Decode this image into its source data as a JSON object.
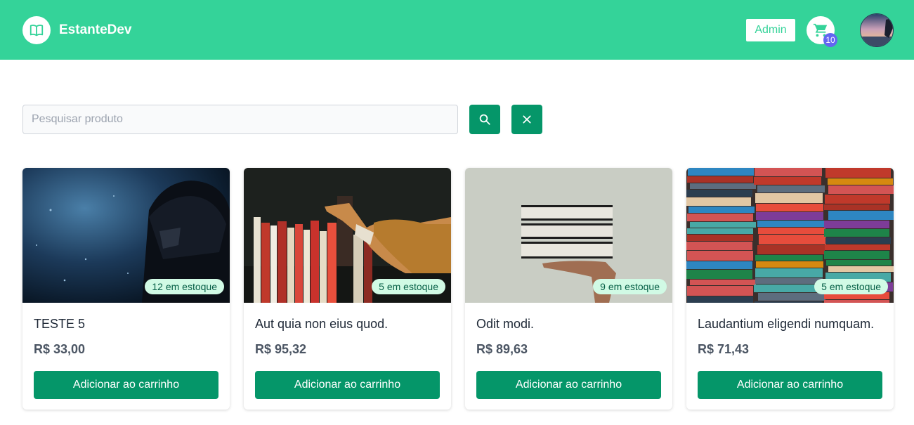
{
  "header": {
    "brand_name": "EstanteDev",
    "brand_icon": "open-book-icon",
    "admin_label": "Admin",
    "cart_icon": "cart-icon",
    "cart_count": "10",
    "colors": {
      "header_bg": "#34d399",
      "badge_bg": "#6366f1"
    }
  },
  "search": {
    "placeholder": "Pesquisar produto",
    "value": "",
    "search_icon": "search-icon",
    "clear_icon": "close-icon"
  },
  "products": [
    {
      "title": "TESTE 5",
      "price": "R$ 33,00",
      "stock": "12 em estoque",
      "button": "Adicionar ao carrinho",
      "image": "dark-helmet-photo"
    },
    {
      "title": "Aut quia non eius quod.",
      "price": "R$ 95,32",
      "stock": "5 em estoque",
      "button": "Adicionar ao carrinho",
      "image": "bookshelf-hand-photo"
    },
    {
      "title": "Odit modi.",
      "price": "R$ 89,63",
      "stock": "9 em estoque",
      "button": "Adicionar ao carrinho",
      "image": "book-stack-hand-photo"
    },
    {
      "title": "Laudantium eligendi numquam.",
      "price": "R$ 71,43",
      "stock": "5 em estoque",
      "button": "Adicionar ao carrinho",
      "image": "colorful-books-photo"
    }
  ],
  "colors": {
    "primary": "#059669",
    "stock_badge_bg": "#d1fae5"
  }
}
